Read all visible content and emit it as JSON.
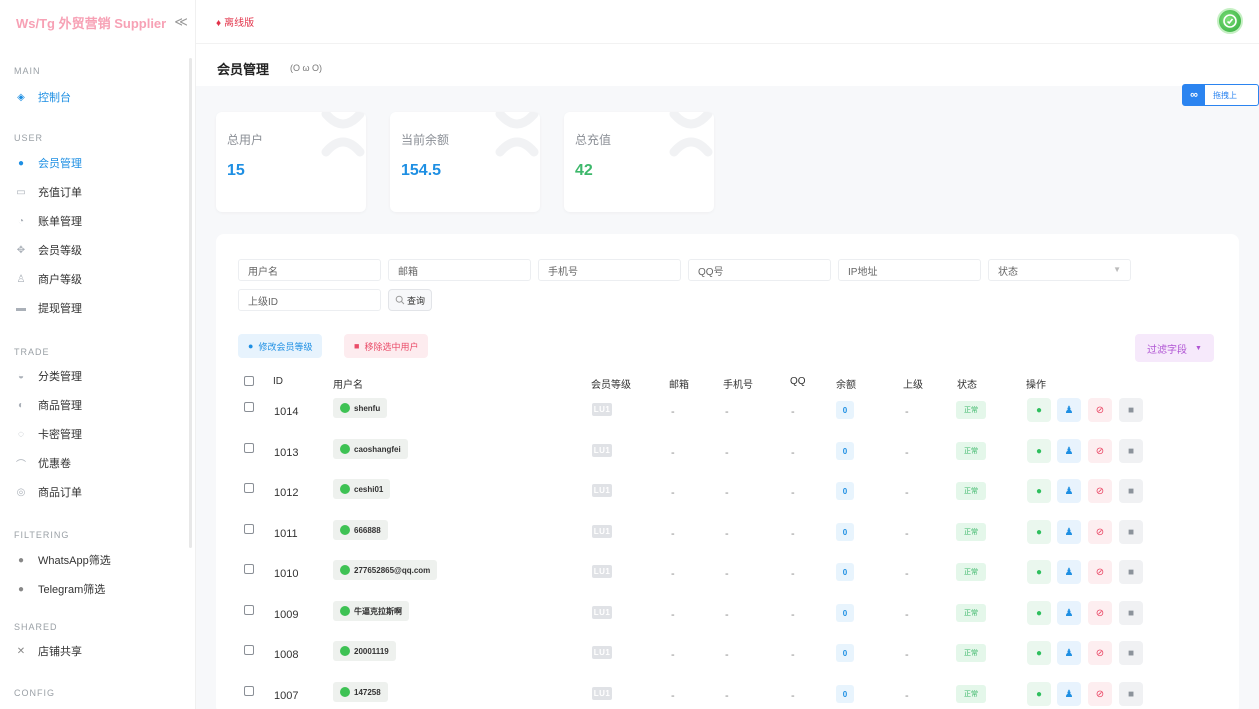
{
  "brand": {
    "title": "Ws/Tg 外贸营销 Supplier",
    "collapse_glyph": "≪"
  },
  "topbar": {
    "offline_label": "离线版",
    "offline_glyph": "♦"
  },
  "page": {
    "title": "会员管理",
    "emote": "(O ω O)"
  },
  "float_button": {
    "logo": "∞",
    "label": "拖拽上"
  },
  "sidebar": {
    "sections": [
      "MAIN",
      "USER",
      "TRADE",
      "FILTERING",
      "SHARED",
      "CONFIG"
    ],
    "items": [
      {
        "label": "控制台",
        "glyph": "◈"
      },
      {
        "label": "会员管理",
        "glyph": "●"
      },
      {
        "label": "充值订单",
        "glyph": "▭"
      },
      {
        "label": "账单管理",
        "glyph": "◔"
      },
      {
        "label": "会员等级",
        "glyph": "✥"
      },
      {
        "label": "商户等级",
        "glyph": "♙"
      },
      {
        "label": "提现管理",
        "glyph": "▬"
      },
      {
        "label": "分类管理",
        "glyph": "◒"
      },
      {
        "label": "商品管理",
        "glyph": "◐"
      },
      {
        "label": "卡密管理",
        "glyph": "◌"
      },
      {
        "label": "优惠卷",
        "glyph": "⌒"
      },
      {
        "label": "商品订单",
        "glyph": "◎"
      },
      {
        "label": "WhatsApp筛选",
        "glyph": "●"
      },
      {
        "label": "Telegram筛选",
        "glyph": "●"
      },
      {
        "label": "店铺共享",
        "glyph": "✕"
      }
    ]
  },
  "stats": [
    {
      "label": "总用户",
      "value": "15",
      "color": "#1e8fe3"
    },
    {
      "label": "当前余额",
      "value": "154.5",
      "color": "#1e8fe3"
    },
    {
      "label": "总充值",
      "value": "42",
      "color": "#3db86b"
    }
  ],
  "filters": {
    "username": "用户名",
    "email": "邮箱",
    "phone": "手机号",
    "qq": "QQ号",
    "ip": "IP地址",
    "status": "状态",
    "parent_id": "上级ID",
    "query": "查询"
  },
  "actions": {
    "edit_level": "修改会员等级",
    "remove_selected": "移除选中用户",
    "filter_fields": "过滤字段"
  },
  "table": {
    "headers": [
      "ID",
      "用户名",
      "会员等级",
      "邮箱",
      "手机号",
      "QQ",
      "余额",
      "上级",
      "状态",
      "操作"
    ],
    "rows": [
      {
        "id": "1014",
        "username": "shenfu",
        "level": "LU1",
        "email": "-",
        "phone": "-",
        "qq": "-",
        "balance": "0",
        "parent": "-",
        "status": "正常"
      },
      {
        "id": "1013",
        "username": "caoshangfei",
        "level": "LU1",
        "email": "-",
        "phone": "-",
        "qq": "-",
        "balance": "0",
        "parent": "-",
        "status": "正常"
      },
      {
        "id": "1012",
        "username": "ceshi01",
        "level": "LU1",
        "email": "-",
        "phone": "-",
        "qq": "-",
        "balance": "0",
        "parent": "-",
        "status": "正常"
      },
      {
        "id": "1011",
        "username": "666888",
        "level": "LU1",
        "email": "-",
        "phone": "-",
        "qq": "-",
        "balance": "0",
        "parent": "-",
        "status": "正常"
      },
      {
        "id": "1010",
        "username": "277652865@qq.com",
        "level": "LU1",
        "email": "-",
        "phone": "-",
        "qq": "-",
        "balance": "0",
        "parent": "-",
        "status": "正常"
      },
      {
        "id": "1009",
        "username": "牛逼克拉斯啊",
        "level": "LU1",
        "email": "-",
        "phone": "-",
        "qq": "-",
        "balance": "0",
        "parent": "-",
        "status": "正常"
      },
      {
        "id": "1008",
        "username": "20001119",
        "level": "LU1",
        "email": "-",
        "phone": "-",
        "qq": "-",
        "balance": "0",
        "parent": "-",
        "status": "正常"
      },
      {
        "id": "1007",
        "username": "147258",
        "level": "LU1",
        "email": "-",
        "phone": "-",
        "qq": "-",
        "balance": "0",
        "parent": "-",
        "status": "正常"
      }
    ]
  },
  "icons": {
    "whatsapp": "whatsapp-icon",
    "user_edit": "user-edit-icon",
    "ban": "ban-icon",
    "trash": "trash-icon"
  },
  "colors": {
    "accent": "#1e8fe3",
    "brand": "#f7a1b5",
    "danger": "#ea3f5f",
    "success": "#3db86b"
  }
}
